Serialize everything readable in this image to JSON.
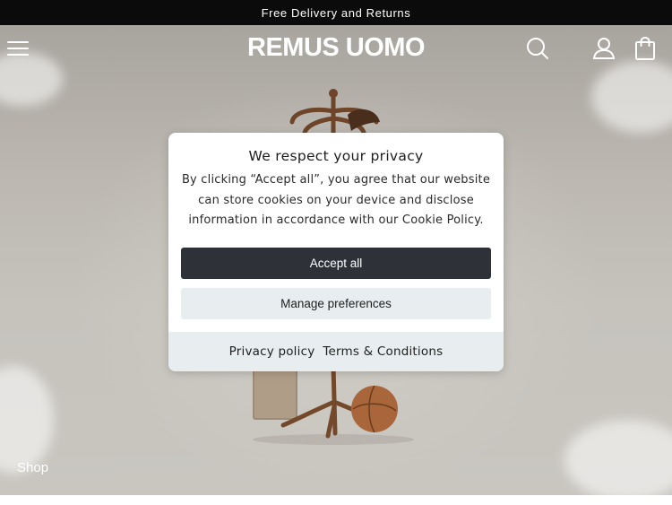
{
  "announcement": {
    "text": "Free Delivery and Returns"
  },
  "header": {
    "brand": "REMUS UOMO",
    "icons": [
      "menu-icon",
      "search-icon",
      "account-icon",
      "cart-icon"
    ]
  },
  "hero": {
    "shop_label": "Shop"
  },
  "cookie_modal": {
    "title": "We respect your privacy",
    "body": "By clicking “Accept all”, you agree that our website can store cookies on your device and disclose information in accordance with our Cookie Policy.",
    "accept_label": "Accept all",
    "manage_label": "Manage preferences",
    "privacy_link": "Privacy policy",
    "terms_link": "Terms & Conditions"
  },
  "colors": {
    "announcement_bg": "#0b0b0b",
    "accept_button_bg": "#2e3238",
    "secondary_bg": "#e8edf0"
  }
}
